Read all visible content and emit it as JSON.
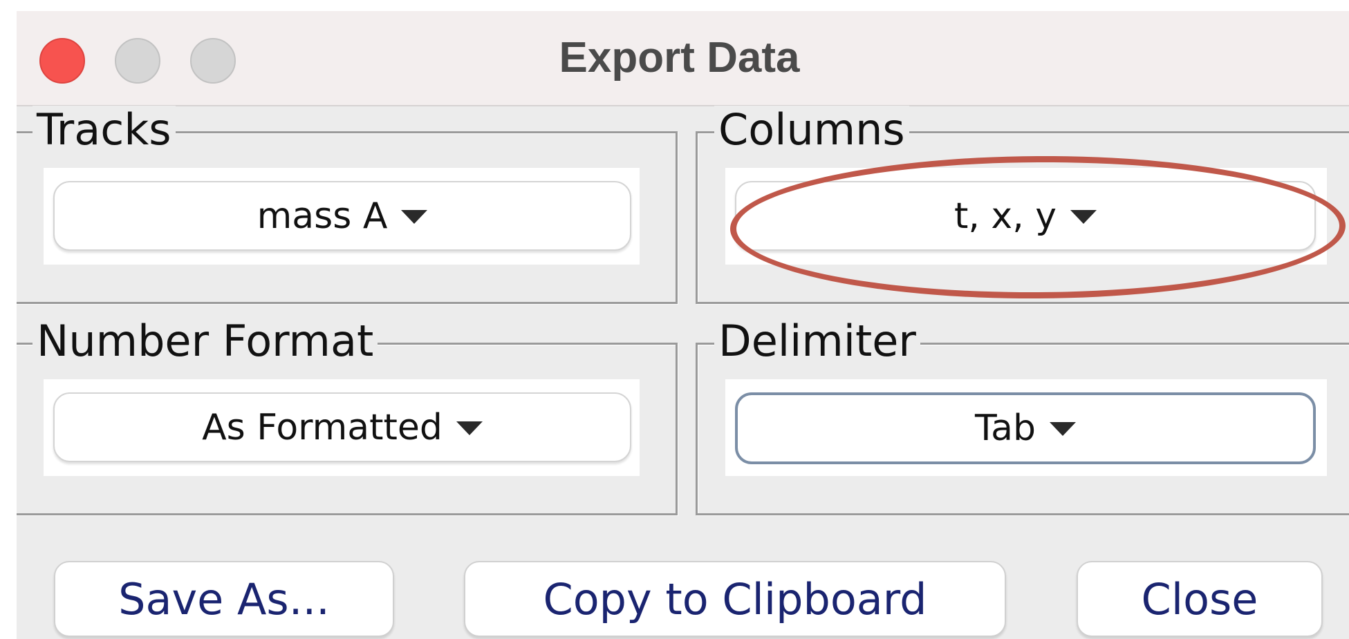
{
  "window": {
    "title": "Export Data",
    "controls": [
      "close",
      "minimize",
      "zoom"
    ]
  },
  "groups": {
    "tracks": {
      "legend": "Tracks",
      "value": "mass A"
    },
    "columns": {
      "legend": "Columns",
      "value": "t, x, y"
    },
    "number_format": {
      "legend": "Number Format",
      "value": "As Formatted"
    },
    "delimiter": {
      "legend": "Delimiter",
      "value": "Tab"
    }
  },
  "buttons": {
    "save_as": "Save As...",
    "copy": "Copy to Clipboard",
    "close": "Close"
  },
  "colors": {
    "annotation_oval": "#c0584a",
    "button_text": "#1a2470",
    "close_light": "#f7534f"
  }
}
